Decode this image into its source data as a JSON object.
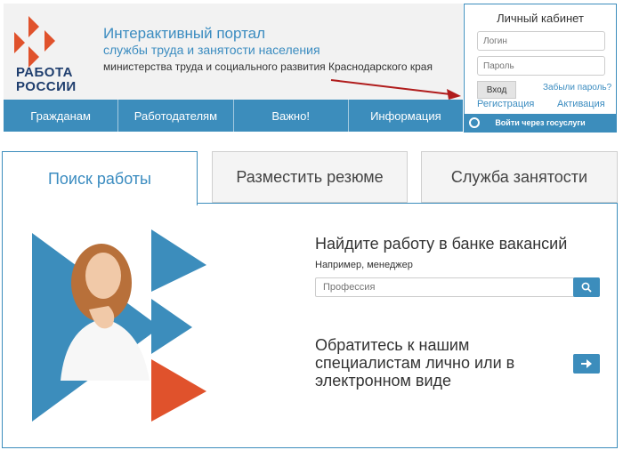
{
  "header": {
    "logo_line1": "РАБОТА",
    "logo_line2": "РОССИИ",
    "portal_title": "Интерактивный портал",
    "portal_subtitle": "службы труда и занятости населения",
    "portal_ministry": "министерства труда и социального развития Краснодарского края"
  },
  "nav": {
    "items": [
      {
        "label": "Гражданам"
      },
      {
        "label": "Работодателям"
      },
      {
        "label": "Важно!"
      },
      {
        "label": "Информация"
      }
    ]
  },
  "login": {
    "title": "Личный кабинет",
    "login_placeholder": "Логин",
    "password_placeholder": "Пароль",
    "login_button": "Вход",
    "forgot_link": "Забыли пароль?",
    "register_link": "Регистрация",
    "activate_link": "Активация",
    "gosuslugi_label": "Войти через госуслуги"
  },
  "tabs": [
    {
      "label": "Поиск работы",
      "active": true
    },
    {
      "label": "Разместить резюме",
      "active": false
    },
    {
      "label": "Служба занятости",
      "active": false
    }
  ],
  "main": {
    "find_title": "Найдите работу в банке вакансий",
    "example_text": "Например, менеджер",
    "search_placeholder": "Профессия",
    "contact_title": "Обратитесь к нашим специалистам лично или в электронном виде"
  },
  "colors": {
    "accent": "#3c8dbc",
    "logo_red": "#e0522c",
    "navy": "#1f3e6e",
    "arrow": "#b01c1c"
  },
  "icons": {
    "search": "search-icon",
    "arrow_right": "arrow-right-icon",
    "gosuslugi": "gosuslugi-icon"
  }
}
